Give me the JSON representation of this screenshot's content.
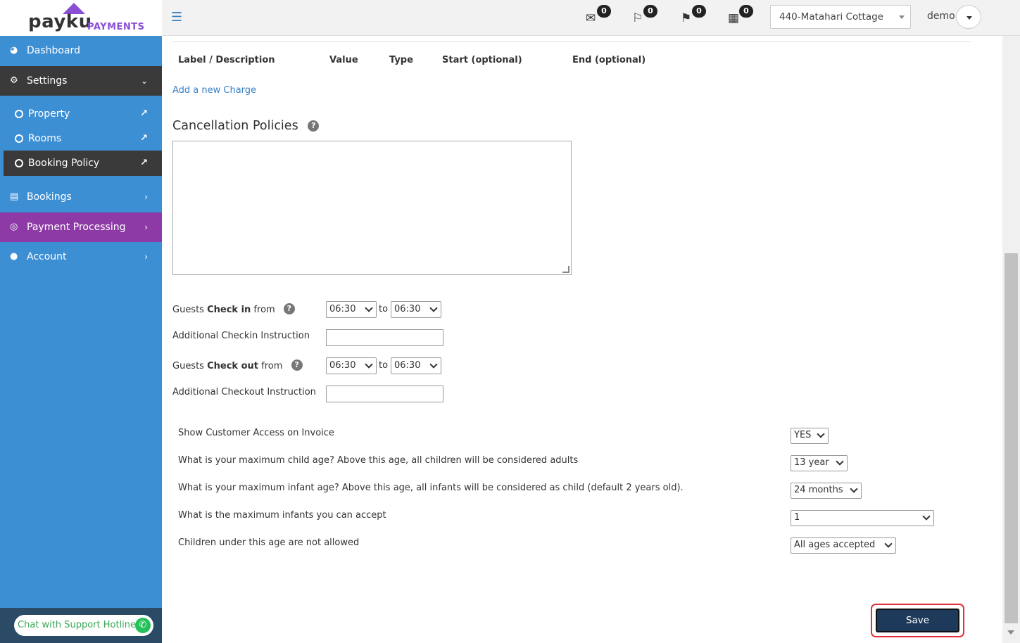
{
  "brand": {
    "name": "payku",
    "sub": "PAYMENTS"
  },
  "header": {
    "icons": [
      {
        "name": "mail-icon",
        "glyph": "✉",
        "count": "0"
      },
      {
        "name": "checkin-icon",
        "glyph": "⚐",
        "count": "0"
      },
      {
        "name": "checkout-icon",
        "glyph": "⚑",
        "count": "0"
      },
      {
        "name": "calendar-icon",
        "glyph": "▦",
        "count": "0"
      }
    ],
    "property": "440-Matahari Cottage",
    "user": "demo"
  },
  "sidebar": {
    "dashboard": "Dashboard",
    "settings": "Settings",
    "property": "Property",
    "rooms": "Rooms",
    "booking_policy": "Booking Policy",
    "bookings": "Bookings",
    "payment_processing": "Payment Processing",
    "account": "Account",
    "support": "Chat with Support Hotline"
  },
  "charges": {
    "headers": [
      "Label / Description",
      "Value",
      "Type",
      "Start (optional)",
      "End (optional)"
    ],
    "add_link": "Add a new Charge"
  },
  "cancellation": {
    "title": "Cancellation Policies",
    "value": ""
  },
  "checkin": {
    "label_pre": "Guests ",
    "label_bold": "Check in",
    "label_post": " from",
    "from": "06:30",
    "to_word": "to",
    "to": "06:30",
    "instruction_label": "Additional Checkin Instruction",
    "instruction_value": ""
  },
  "checkout": {
    "label_pre": "Guests ",
    "label_bold": "Check out",
    "label_post": " from",
    "from": "06:30",
    "to_word": "to",
    "to": "06:30",
    "instruction_label": "Additional Checkout Instruction",
    "instruction_value": ""
  },
  "questions": [
    {
      "label": "Show Customer Access on Invoice",
      "value": "YES"
    },
    {
      "label": "What is your maximum child age? Above this age, all children will be considered adults",
      "value": "13 year"
    },
    {
      "label": "What is your maximum infant age? Above this age, all infants will be considered as child (default 2 years old).",
      "value": "24 months"
    },
    {
      "label": "What is the maximum infants you can accept",
      "value": "1"
    },
    {
      "label": "Children under this age are not allowed",
      "value": "All ages accepted"
    }
  ],
  "save": "Save",
  "colors": {
    "sidebar": "#3d8fd4",
    "settings_bg": "#3a3a3a",
    "payment_bg": "#8e3aa6",
    "brand_purple": "#8a4fd6",
    "save_bg": "#1e3a5a",
    "highlight": "#e0303a"
  }
}
